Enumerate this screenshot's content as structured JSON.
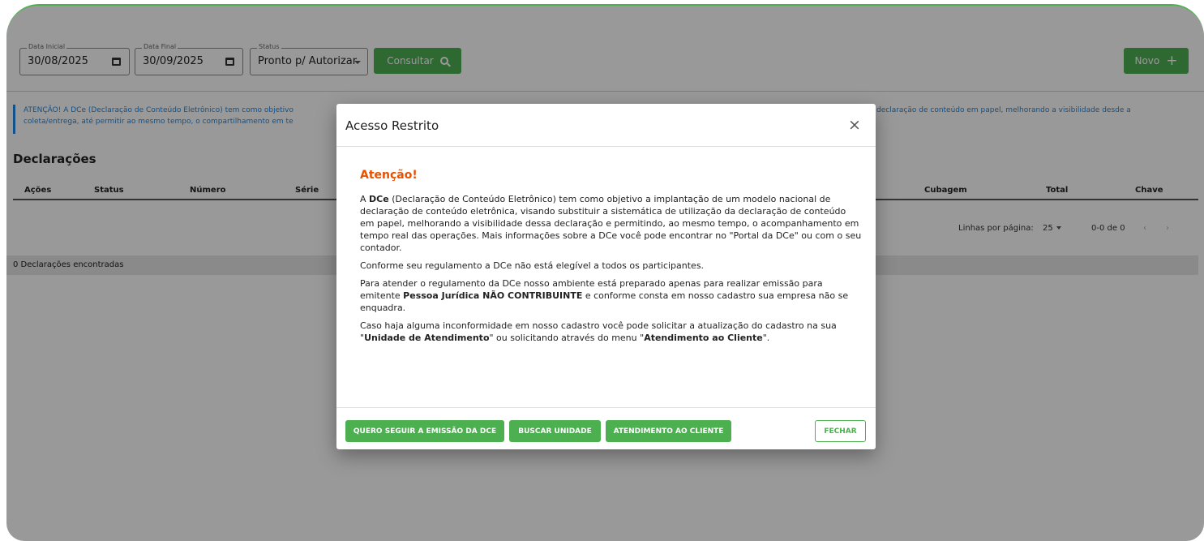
{
  "filters": {
    "date_start": {
      "label": "Data Inicial",
      "value": "30/08/2025"
    },
    "date_end": {
      "label": "Data Final",
      "value": "30/09/2025"
    },
    "status": {
      "label": "Status",
      "value": "Pronto p/ Autorizar"
    },
    "consult_label": "Consultar",
    "new_label": "Novo"
  },
  "info": {
    "line1_left": "ATENÇÃO! A DCe (Declaração de Conteúdo Eletrônico) tem como objetivo",
    "line1_right": "declaração de conteúdo em papel, melhorando a visibilidade desde a",
    "line2_left": "coleta/entrega, até permitir ao mesmo tempo, o compartilhamento em te"
  },
  "section_title": "Declarações",
  "table": {
    "headers": [
      "Ações",
      "Status",
      "Número",
      "Série",
      "Cubagem",
      "Total",
      "Chave"
    ]
  },
  "pagination": {
    "rows_per_page_label": "Linhas por página:",
    "rows_per_page": "25",
    "range": "0-0 de 0"
  },
  "count_text": "0 Declarações encontradas",
  "modal": {
    "title": "Acesso Restrito",
    "attention": "Atenção!",
    "p1_a": "A ",
    "p1_bold": "DCe",
    "p1_b": " (Declaração de Conteúdo Eletrônico) tem como objetivo a implantação de um modelo nacional de declaração de conteúdo eletrônica, visando substituir a sistemática de utilização da declaração de conteúdo em papel, melhorando a visibilidade dessa declaração e permitindo, ao mesmo tempo, o acompanhamento em tempo real das operações. Mais informações sobre a DCe você pode encontrar no \"Portal da DCe\" ou com o seu contador.",
    "p2": "Conforme seu regulamento a DCe não está elegível a todos os participantes.",
    "p3_a": "Para atender o regulamento da DCe nosso ambiente está preparado apenas para realizar emissão para emitente ",
    "p3_bold": "Pessoa Jurídica NÃO CONTRIBUINTE",
    "p3_b": " e conforme consta em nosso cadastro sua empresa não se enquadra.",
    "p4_a": "Caso haja alguma inconformidade em nosso cadastro você pode solicitar a atualização do cadastro na sua \"",
    "p4_bold1": "Unidade de Atendimento",
    "p4_b": "\" ou solicitando através do menu \"",
    "p4_bold2": "Atendimento ao Cliente",
    "p4_c": "\".",
    "buttons": {
      "continue": "QUERO SEGUIR A EMISSÃO DA DCE",
      "find_unit": "BUSCAR UNIDADE",
      "support": "ATENDIMENTO AO CLIENTE",
      "close": "FECHAR"
    }
  },
  "colors": {
    "accent_green": "#4caf50",
    "info_blue": "#1e88e5",
    "attention_orange": "#e65100"
  }
}
